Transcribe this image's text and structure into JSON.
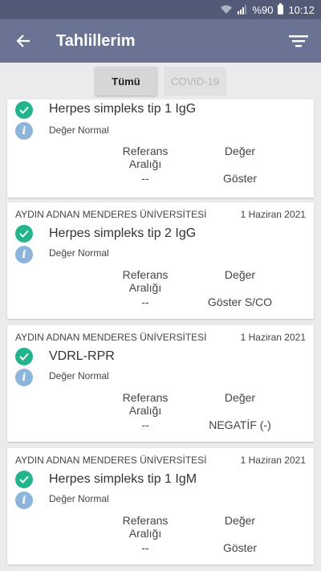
{
  "status_bar": {
    "battery": "%90",
    "time": "10:12"
  },
  "app_bar": {
    "title": "Tahlillerim"
  },
  "tabs": [
    {
      "label": "Tümü"
    },
    {
      "label": "COVID-19"
    }
  ],
  "columns": {
    "reference": "Referans Aralığı",
    "value": "Değer"
  },
  "cards": [
    {
      "institution": "",
      "date": "",
      "test": "Herpes simpleks tip 1 IgG",
      "status": "Değer Normal",
      "reference": "--",
      "value": "Göster"
    },
    {
      "institution": "AYDIN ADNAN MENDERES ÜNİVERSİTESİ",
      "date": "1 Haziran 2021",
      "test": "Herpes simpleks tip 2 IgG",
      "status": "Değer Normal",
      "reference": "--",
      "value": "Göster S/CO"
    },
    {
      "institution": "AYDIN ADNAN MENDERES ÜNİVERSİTESİ",
      "date": "1 Haziran 2021",
      "test": "VDRL-RPR",
      "status": "Değer Normal",
      "reference": "--",
      "value": "NEGATİF (-)"
    },
    {
      "institution": "AYDIN ADNAN MENDERES ÜNİVERSİTESİ",
      "date": "1 Haziran 2021",
      "test": "Herpes simpleks tip 1 IgM",
      "status": "Değer Normal",
      "reference": "--",
      "value": "Göster"
    }
  ]
}
